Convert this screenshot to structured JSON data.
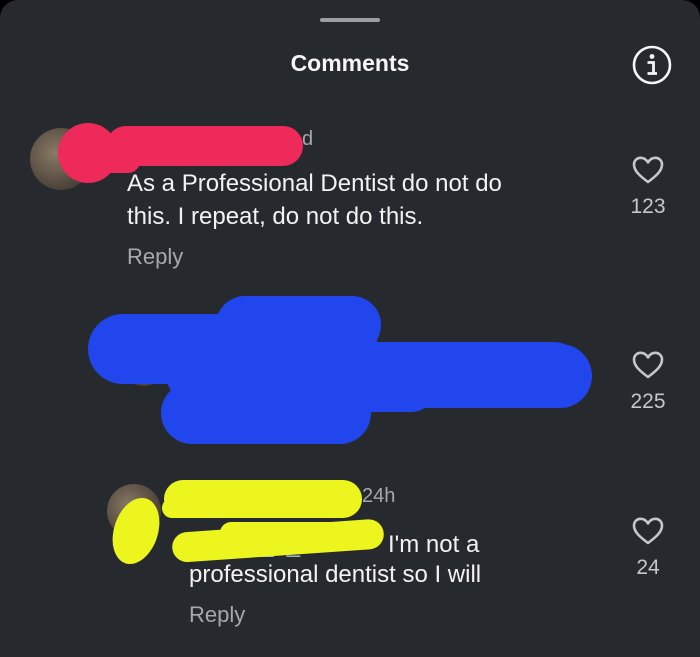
{
  "header": {
    "title": "Comments",
    "info_icon": "info-icon"
  },
  "comments": [
    {
      "time": "d",
      "text_line1": "As a Professional Dentist do not do",
      "text_line2": "this. I repeat, do not do this.",
      "reply_label": "Reply",
      "likes": "123"
    },
    {
      "likes": "225"
    },
    {
      "time": "24h",
      "text_line1": "I'm not a",
      "text_line2": "professional dentist so I will",
      "reply_label": "Reply",
      "likes": "24"
    }
  ],
  "colors": {
    "background": "#262a2e",
    "text": "#f2f2f2",
    "muted": "#a5a9ad",
    "scribble_red": "#ee2a5a",
    "scribble_blue": "#2246ee",
    "scribble_yellow": "#ecf51e"
  }
}
